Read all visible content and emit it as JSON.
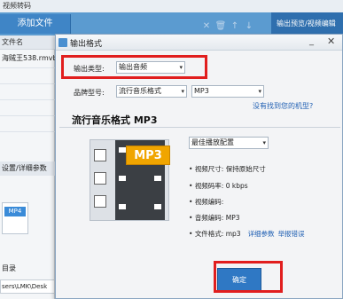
{
  "main_window": {
    "title": "视频转码",
    "add_file_label": "添加文件",
    "toolbar_icons": [
      "close-icon",
      "trash-icon",
      "arrow-up-icon",
      "arrow-down-icon"
    ],
    "right_header": "输出预览/视频编辑",
    "file_column_header": "文件名",
    "file_name": "海贼王538.rmvb",
    "settings_label": "设置/详细参数",
    "format_badge": "MP4",
    "dir_label": "目录",
    "dir_path": "sers\\LMK\\Desk"
  },
  "dialog": {
    "title": "输出格式",
    "output_type_label": "输出类型:",
    "output_type_value": "输出音频",
    "brand_label": "品牌型号:",
    "brand_value": "流行音乐格式",
    "model_value": "MP3",
    "help_link": "没有找到您的机型?",
    "section_title": "流行音乐格式 MP3",
    "quality_value": "最佳播放配置",
    "format_tag": "MP3",
    "info": {
      "video_size": "视频尺寸: 保持原始尺寸",
      "video_bitrate": "视频码率: 0 kbps",
      "video_codec": "视频编码:",
      "audio_codec": "音频编码: MP3",
      "file_format": "文件格式: mp3"
    },
    "detail_link": "详细参数",
    "report_link": "举报错误",
    "confirm_label": "确定"
  },
  "highlight_color": "#e11e1e"
}
